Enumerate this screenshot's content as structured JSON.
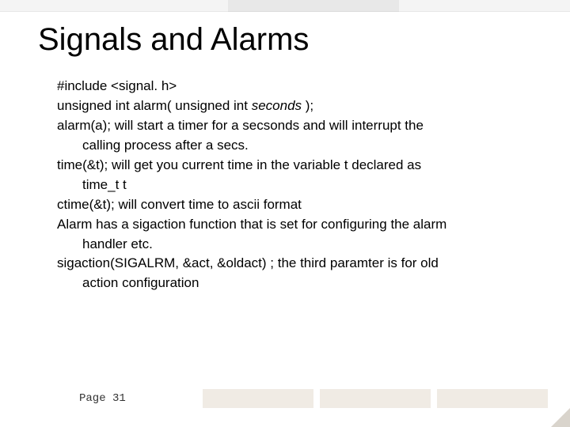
{
  "title": "Signals and Alarms",
  "body": {
    "l1": "#include <signal. h>",
    "l2_pre": "unsigned int alarm( unsigned int ",
    "l2_em": "seconds",
    "l2_post": " );",
    "l3": "alarm(a); will start a timer for a secsonds and will interrupt the",
    "l3b": "calling process after a secs.",
    "l4": "time(&t); will get you current time in the variable t declared as",
    "l4b": "time_t t",
    "l5": "ctime(&t); will convert time to ascii format",
    "l6": "Alarm has a sigaction function that is set for configuring the alarm",
    "l6b": "handler etc.",
    "l7": "sigaction(SIGALRM, &act, &oldact) ; the third paramter is for old",
    "l7b": "action configuration"
  },
  "footer": {
    "page": "Page 31"
  }
}
